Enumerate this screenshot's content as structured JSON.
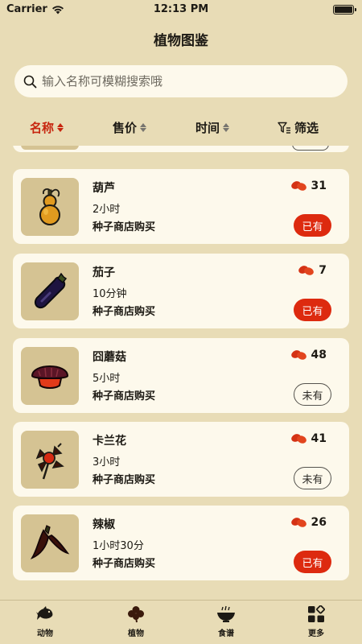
{
  "status": {
    "carrier": "Carrier",
    "time": "12:13 PM"
  },
  "header": {
    "title": "植物图鉴"
  },
  "search": {
    "placeholder": "输入名称可模糊搜索哦"
  },
  "sort": {
    "items": [
      {
        "label": "名称",
        "active": true
      },
      {
        "label": "售价",
        "active": false
      },
      {
        "label": "时间",
        "active": false
      }
    ],
    "filter_label": "筛选"
  },
  "plants": [
    {
      "name": "葫芦",
      "time": "2小时",
      "source": "种子商店购买",
      "price": "31",
      "status": "已有",
      "owned": true,
      "icon": "gourd-image"
    },
    {
      "name": "茄子",
      "time": "10分钟",
      "source": "种子商店购买",
      "price": "7",
      "status": "已有",
      "owned": true,
      "icon": "eggplant-image"
    },
    {
      "name": "囧蘑菇",
      "time": "5小时",
      "source": "种子商店购买",
      "price": "48",
      "status": "未有",
      "owned": false,
      "icon": "mushroom-image"
    },
    {
      "name": "卡兰花",
      "time": "3小时",
      "source": "种子商店购买",
      "price": "41",
      "status": "未有",
      "owned": false,
      "icon": "flower-image"
    },
    {
      "name": "辣椒",
      "time": "1小时30分",
      "source": "种子商店购买",
      "price": "26",
      "status": "已有",
      "owned": true,
      "icon": "pepper-image"
    }
  ],
  "tabs": [
    {
      "label": "动物",
      "icon": "fish-icon"
    },
    {
      "label": "植物",
      "icon": "clover-icon"
    },
    {
      "label": "食谱",
      "icon": "bowl-icon"
    },
    {
      "label": "更多",
      "icon": "grid-icon"
    }
  ],
  "colors": {
    "accent": "#dd2a0f",
    "background": "#e8dcb6",
    "card": "#fdf9ec",
    "image_bg": "#d5c393"
  }
}
